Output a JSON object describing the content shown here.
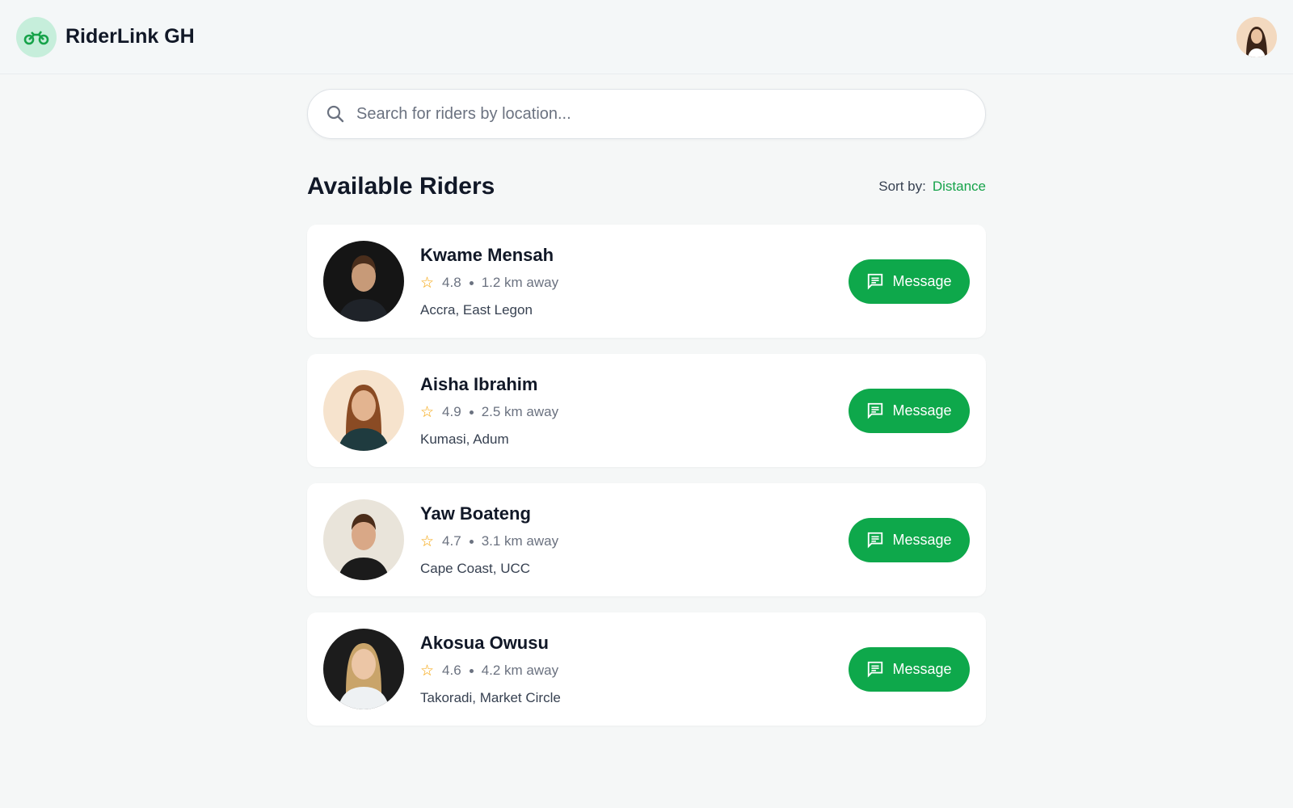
{
  "app": {
    "title": "RiderLink GH",
    "logo_icon": "motorcycle-icon"
  },
  "search": {
    "placeholder": "Search for riders by location..."
  },
  "list": {
    "heading": "Available Riders",
    "sort_label": "Sort by:",
    "sort_value": "Distance"
  },
  "colors": {
    "accent": "#0ea84b",
    "star": "#f5a100"
  },
  "riders": [
    {
      "name": "Kwame Mensah",
      "rating": "4.8",
      "distance": "1.2 km away",
      "location": "Accra, East Legon",
      "button": "Message"
    },
    {
      "name": "Aisha Ibrahim",
      "rating": "4.9",
      "distance": "2.5 km away",
      "location": "Kumasi, Adum",
      "button": "Message"
    },
    {
      "name": "Yaw Boateng",
      "rating": "4.7",
      "distance": "3.1 km away",
      "location": "Cape Coast, UCC",
      "button": "Message"
    },
    {
      "name": "Akosua Owusu",
      "rating": "4.6",
      "distance": "4.2 km away",
      "location": "Takoradi, Market Circle",
      "button": "Message"
    }
  ]
}
